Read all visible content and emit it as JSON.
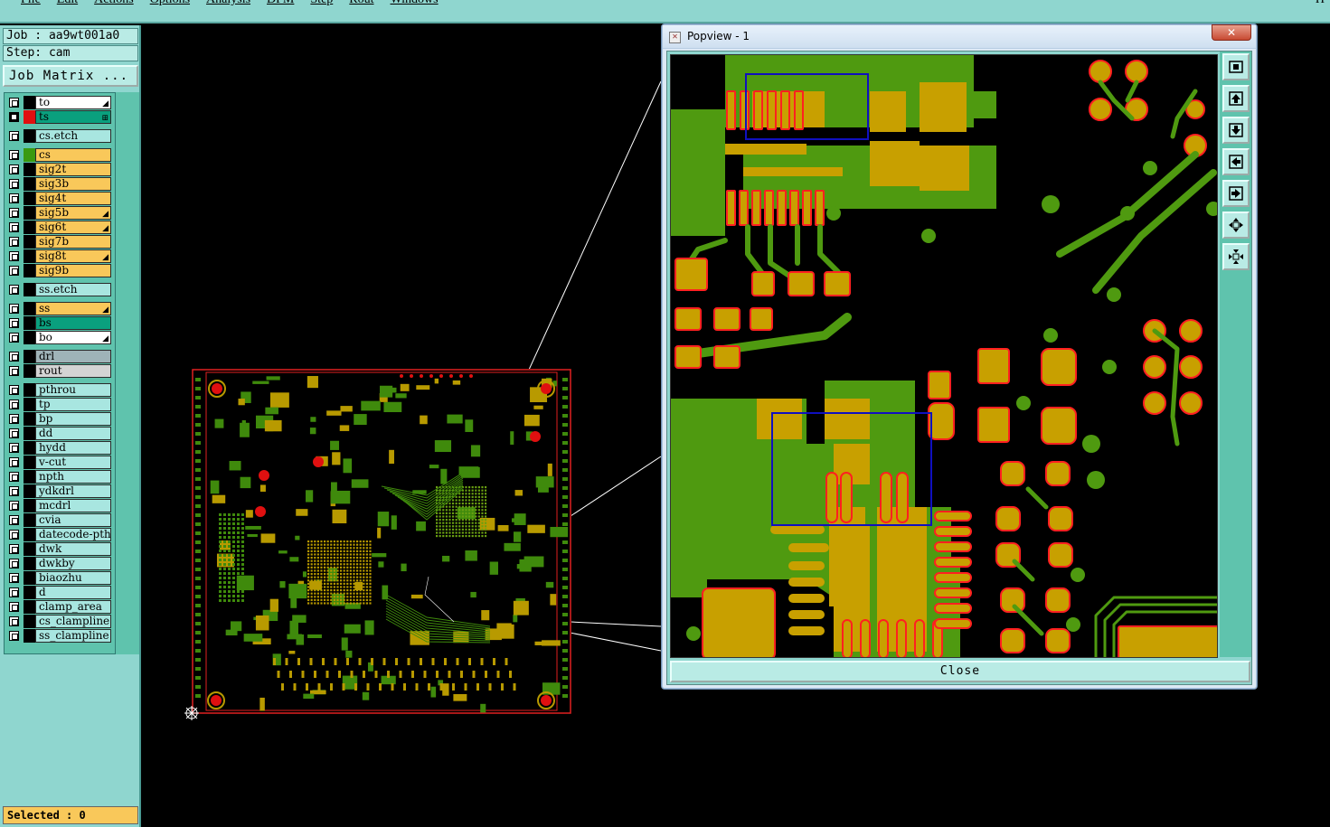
{
  "menubar": {
    "items": [
      "File",
      "Edit",
      "Actions",
      "Options",
      "Analysis",
      "DFM",
      "Step",
      "Rout",
      "Windows"
    ],
    "right_letter": "H"
  },
  "left_panel": {
    "job_label": "Job : aa9wt001a0",
    "step_label": "Step: cam",
    "job_matrix_label": "Job Matrix ...",
    "selected_label": "Selected : 0"
  },
  "layers": [
    {
      "name": "to",
      "color": "#ffffff",
      "swatch": "#000000",
      "mark": "brush"
    },
    {
      "name": "ts",
      "color": "#0aa07e",
      "swatch": "#e01010",
      "mark": "grid",
      "active": true
    },
    {
      "name": "cs.etch",
      "color": "#a8e6e0",
      "swatch": "#000000"
    },
    {
      "name": "cs",
      "color": "#f9c85a",
      "swatch": "#3a9a10"
    },
    {
      "name": "sig2t",
      "color": "#f9c85a",
      "swatch": "#000000"
    },
    {
      "name": "sig3b",
      "color": "#f9c85a",
      "swatch": "#000000"
    },
    {
      "name": "sig4t",
      "color": "#f9c85a",
      "swatch": "#000000"
    },
    {
      "name": "sig5b",
      "color": "#f9c85a",
      "swatch": "#000000",
      "mark": "brush"
    },
    {
      "name": "sig6t",
      "color": "#f9c85a",
      "swatch": "#000000",
      "mark": "brush"
    },
    {
      "name": "sig7b",
      "color": "#f9c85a",
      "swatch": "#000000"
    },
    {
      "name": "sig8t",
      "color": "#f9c85a",
      "swatch": "#000000",
      "mark": "brush"
    },
    {
      "name": "sig9b",
      "color": "#f9c85a",
      "swatch": "#000000"
    },
    {
      "name": "ss.etch",
      "color": "#a8e6e0",
      "swatch": "#000000"
    },
    {
      "name": "ss",
      "color": "#f9c85a",
      "swatch": "#000000",
      "mark": "brush"
    },
    {
      "name": "bs",
      "color": "#0aa07e",
      "swatch": "#000000"
    },
    {
      "name": "bo",
      "color": "#ffffff",
      "swatch": "#000000",
      "mark": "brush"
    },
    {
      "name": "drl",
      "color": "#9fb3b8",
      "swatch": "#000000"
    },
    {
      "name": "rout",
      "color": "#d4d4d4",
      "swatch": "#000000"
    },
    {
      "name": "pthrou",
      "color": "#a8e6e0",
      "swatch": "#000000"
    },
    {
      "name": "tp",
      "color": "#a8e6e0",
      "swatch": "#000000"
    },
    {
      "name": "bp",
      "color": "#a8e6e0",
      "swatch": "#000000"
    },
    {
      "name": "dd",
      "color": "#a8e6e0",
      "swatch": "#000000"
    },
    {
      "name": "hydd",
      "color": "#a8e6e0",
      "swatch": "#000000"
    },
    {
      "name": "v-cut",
      "color": "#a8e6e0",
      "swatch": "#000000"
    },
    {
      "name": "npth",
      "color": "#a8e6e0",
      "swatch": "#000000"
    },
    {
      "name": "ydkdrl",
      "color": "#a8e6e0",
      "swatch": "#000000"
    },
    {
      "name": "mcdrl",
      "color": "#a8e6e0",
      "swatch": "#000000"
    },
    {
      "name": "cvia",
      "color": "#a8e6e0",
      "swatch": "#000000"
    },
    {
      "name": "datecode-pth",
      "color": "#a8e6e0",
      "swatch": "#000000"
    },
    {
      "name": "dwk",
      "color": "#a8e6e0",
      "swatch": "#000000"
    },
    {
      "name": "dwkby",
      "color": "#a8e6e0",
      "swatch": "#000000"
    },
    {
      "name": "biaozhu",
      "color": "#a8e6e0",
      "swatch": "#000000"
    },
    {
      "name": "d",
      "color": "#a8e6e0",
      "swatch": "#000000"
    },
    {
      "name": "clamp_area",
      "color": "#a8e6e0",
      "swatch": "#000000"
    },
    {
      "name": "cs_clampline",
      "color": "#a8e6e0",
      "swatch": "#000000"
    },
    {
      "name": "ss_clampline",
      "color": "#a8e6e0",
      "swatch": "#000000"
    }
  ],
  "popview": {
    "title": "Popview - 1",
    "close_x": "✕",
    "close_label": "Close",
    "toolbar_icons": [
      "zoom-fit-icon",
      "pan-up-icon",
      "pan-down-icon",
      "pan-left-icon",
      "pan-right-icon",
      "zoom-in-icon",
      "zoom-out-icon"
    ]
  },
  "colors": {
    "copper": "#4f9a10",
    "pad": "#c8a000",
    "pad_outline": "#ff2020",
    "panel": "#8fd6cf",
    "selection_box": "#1010c0"
  }
}
